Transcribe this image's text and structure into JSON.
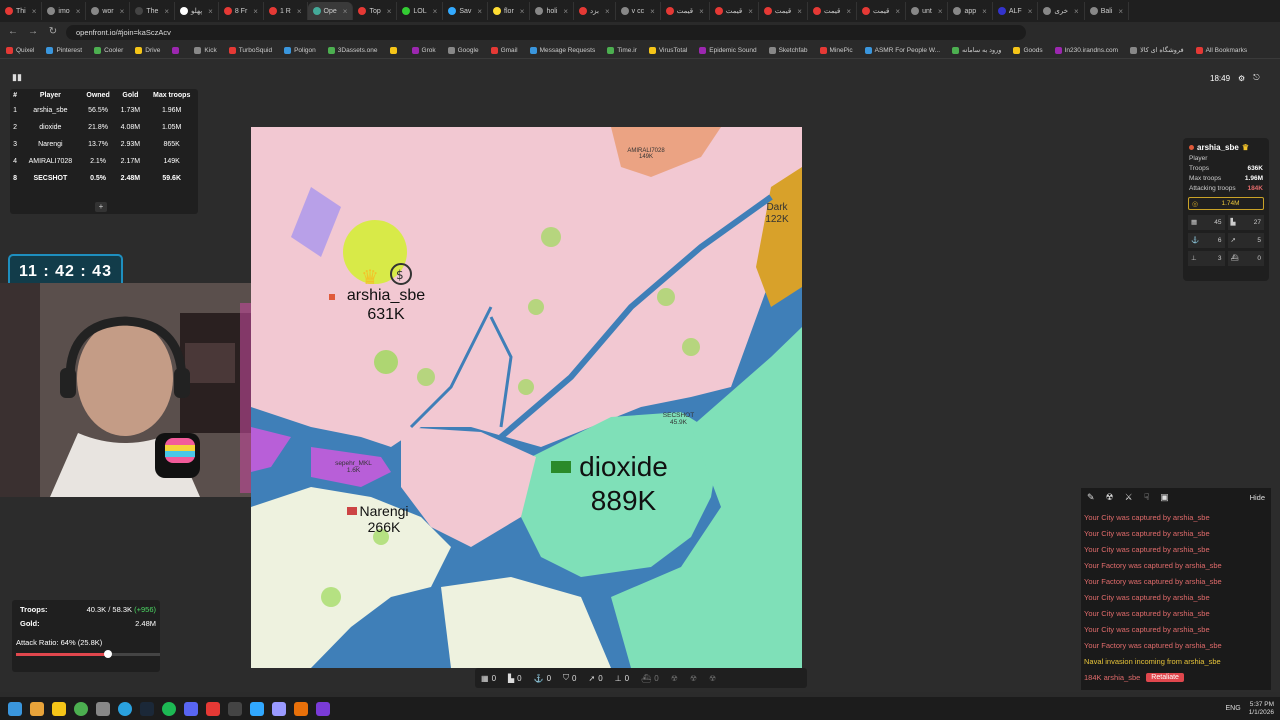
{
  "browser": {
    "tabs": [
      {
        "label": "Thi",
        "color": "#e53935"
      },
      {
        "label": "imo",
        "color": "#888"
      },
      {
        "label": "wor",
        "color": "#888"
      },
      {
        "label": "The",
        "color": "#444"
      },
      {
        "label": "پهلو",
        "color": "#fff"
      },
      {
        "label": "8 Fr",
        "color": "#e53935"
      },
      {
        "label": "1 R",
        "color": "#e53935"
      },
      {
        "label": "Ope",
        "color": "#4a9"
      },
      {
        "label": "Top",
        "color": "#e53935"
      },
      {
        "label": "LOL",
        "color": "#3c3"
      },
      {
        "label": "Sav",
        "color": "#3af"
      },
      {
        "label": "flor",
        "color": "#fd3"
      },
      {
        "label": "holi",
        "color": "#888"
      },
      {
        "label": "بزد",
        "color": "#e53935"
      },
      {
        "label": "v cc",
        "color": "#888"
      },
      {
        "label": "قیمت",
        "color": "#e53935"
      },
      {
        "label": "قیمت",
        "color": "#e53935"
      },
      {
        "label": "قیمت",
        "color": "#e53935"
      },
      {
        "label": "قیمت",
        "color": "#e53935"
      },
      {
        "label": "قیمت",
        "color": "#e53935"
      },
      {
        "label": "unt",
        "color": "#888"
      },
      {
        "label": "app",
        "color": "#888"
      },
      {
        "label": "ALF",
        "color": "#33c"
      },
      {
        "label": "خری",
        "color": "#888"
      },
      {
        "label": "Bali",
        "color": "#888"
      }
    ],
    "url": "openfront.io/#join=kaSczAcv",
    "bookmarks": [
      "Quixel",
      "Pinterest",
      "Cooler",
      "Drive",
      "",
      "Kick",
      "TurboSquid",
      "Poligon",
      "3Dassets.one",
      "",
      "Grok",
      "Google",
      "Gmail",
      "Message Requests",
      "Time.ir",
      "VirusTotal",
      "Epidemic Sound",
      "Sketchfab",
      "MinePic",
      "ASMR For People W...",
      "ورود به سامانه",
      "Goods",
      "In230.irandns.com",
      "فروشگاه ای کالا",
      "All Bookmarks"
    ]
  },
  "game": {
    "clock": "18:49",
    "leaderboard": {
      "headers": [
        "#",
        "Player",
        "Owned",
        "Gold",
        "Max troops"
      ],
      "rows": [
        [
          "1",
          "arshia_sbe",
          "56.5%",
          "1.73M",
          "1.96M"
        ],
        [
          "2",
          "dioxide",
          "21.8%",
          "4.08M",
          "1.05M"
        ],
        [
          "3",
          "Narengi",
          "13.7%",
          "2.93M",
          "865K"
        ],
        [
          "4",
          "AMIRALI7028",
          "2.1%",
          "2.17M",
          "149K"
        ],
        [
          "8",
          "SECSHOT",
          "0.5%",
          "2.48M",
          "59.6K"
        ]
      ],
      "more": "+"
    },
    "timer": "11 : 42 : 43",
    "map_labels": {
      "arshia_name": "arshia_sbe",
      "arshia_troops": "631K",
      "dioxide_name": "dioxide",
      "dioxide_troops": "889K",
      "narengi_name": "Narengi",
      "narengi_troops": "266K",
      "amirali_name": "AMIRALI7028",
      "amirali_troops": "149K",
      "dark_name": "Dark",
      "dark_troops": "122K",
      "secshot_name": "SECSHOT",
      "secshot_troops": "45.9K",
      "sepehr_name": "sepehr_MKL",
      "sepehr_troops": "1.6K"
    },
    "player_panel": {
      "name": "arshia_sbe",
      "type": "Player",
      "stats": [
        {
          "label": "Troops",
          "value": "636K"
        },
        {
          "label": "Max troops",
          "value": "1.96M"
        },
        {
          "label": "Attacking troops",
          "value": "184K"
        }
      ],
      "gold": "1.74M",
      "buildings": [
        {
          "icon": "city-icon",
          "value": "45"
        },
        {
          "icon": "factory-icon",
          "value": "27"
        },
        {
          "icon": "port-icon",
          "value": "6"
        },
        {
          "icon": "missile-icon",
          "value": "5"
        },
        {
          "icon": "sam-icon",
          "value": "3"
        },
        {
          "icon": "warship-icon",
          "value": "0"
        }
      ]
    },
    "events": {
      "hide_label": "Hide",
      "items": [
        {
          "text": "Your City was captured by arshia_sbe",
          "kind": "red"
        },
        {
          "text": "Your City was captured by arshia_sbe",
          "kind": "red"
        },
        {
          "text": "Your City was captured by arshia_sbe",
          "kind": "red"
        },
        {
          "text": "Your Factory was captured by arshia_sbe",
          "kind": "red"
        },
        {
          "text": "Your Factory was captured by arshia_sbe",
          "kind": "red"
        },
        {
          "text": "Your City was captured by arshia_sbe",
          "kind": "red"
        },
        {
          "text": "Your City was captured by arshia_sbe",
          "kind": "red"
        },
        {
          "text": "Your City was captured by arshia_sbe",
          "kind": "red"
        },
        {
          "text": "Your Factory was captured by arshia_sbe",
          "kind": "red"
        },
        {
          "text": "Naval invasion incoming from arshia_sbe",
          "kind": "yellow"
        }
      ],
      "attack_text": "184K arshia_sbe",
      "retaliate_label": "Retaliate"
    },
    "troops_box": {
      "troops_label": "Troops:",
      "troops_value": "40.3K / 58.3K",
      "troops_delta": "(+956)",
      "gold_label": "Gold:",
      "gold_value": "2.48M",
      "attack_ratio": "Attack Ratio: 64% (25.8K)",
      "attack_ratio_value": 0.64
    },
    "bottom_counts": [
      "0",
      "0",
      "0",
      "0",
      "0",
      "0",
      "0"
    ]
  },
  "taskbar": {
    "lang": "ENG",
    "time": "5:37 PM",
    "date": "1/1/2026"
  },
  "colors": {
    "arshia": "#f2c8d2",
    "dioxide": "#7fe0b8",
    "narengi": "#eef2df",
    "water": "#3f7fb8",
    "amirali": "#eba383",
    "dark": "#d8a12a",
    "sepehr": "#b85fd8",
    "accent_red": "#e0474d"
  }
}
